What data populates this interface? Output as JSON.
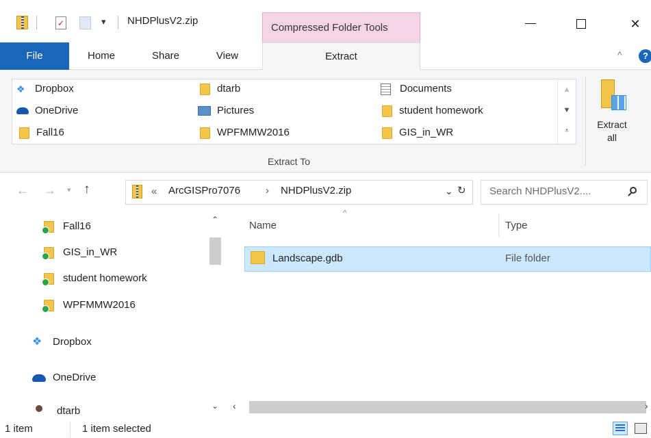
{
  "window": {
    "title": "NHDPlusV2.zip",
    "context_tab": "Compressed Folder Tools",
    "controls": {
      "minimize": "—",
      "maximize": "☐",
      "close": "✕"
    }
  },
  "ribbon": {
    "tabs": [
      "File",
      "Home",
      "Share",
      "View",
      "Extract"
    ],
    "active_tab": "Extract",
    "extract_to_label": "Extract To",
    "extract_all_label": [
      "Extract",
      "all"
    ],
    "destinations": [
      {
        "label": "Dropbox",
        "icon": "dropbox-icon"
      },
      {
        "label": "OneDrive",
        "icon": "onedrive-icon"
      },
      {
        "label": "Fall16",
        "icon": "folder-icon"
      },
      {
        "label": "dtarb",
        "icon": "folder-icon"
      },
      {
        "label": "Pictures",
        "icon": "pictures-folder-icon"
      },
      {
        "label": "WPFMMW2016",
        "icon": "folder-icon"
      },
      {
        "label": "Documents",
        "icon": "documents-icon"
      },
      {
        "label": "student homework",
        "icon": "folder-icon"
      },
      {
        "label": "GIS_in_WR",
        "icon": "folder-icon"
      }
    ]
  },
  "navbar": {
    "breadcrumb_prefix": "«",
    "breadcrumb": [
      "ArcGISPro7076",
      "NHDPlusV2.zip"
    ],
    "search_placeholder": "Search NHDPlusV2...."
  },
  "sidebar": {
    "items": [
      {
        "label": "Fall16",
        "icon": "synced-folder-icon"
      },
      {
        "label": "GIS_in_WR",
        "icon": "synced-folder-icon"
      },
      {
        "label": "student homework",
        "icon": "synced-folder-icon"
      },
      {
        "label": "WPFMMW2016",
        "icon": "synced-folder-icon"
      },
      {
        "label": "Dropbox",
        "icon": "dropbox-icon"
      },
      {
        "label": "OneDrive",
        "icon": "onedrive-icon"
      },
      {
        "label": "dtarb",
        "icon": "user-icon"
      }
    ]
  },
  "file_list": {
    "columns": [
      "Name",
      "Type"
    ],
    "rows": [
      {
        "name": "Landscape.gdb",
        "type": "File folder",
        "selected": true
      }
    ]
  },
  "status": {
    "item_count": "1 item",
    "selection": "1 item selected"
  },
  "colors": {
    "file_tab": "#1a66b8",
    "context_tab": "#f6d4e8",
    "selection": "#cce8ff",
    "folder": "#f4c54b"
  }
}
